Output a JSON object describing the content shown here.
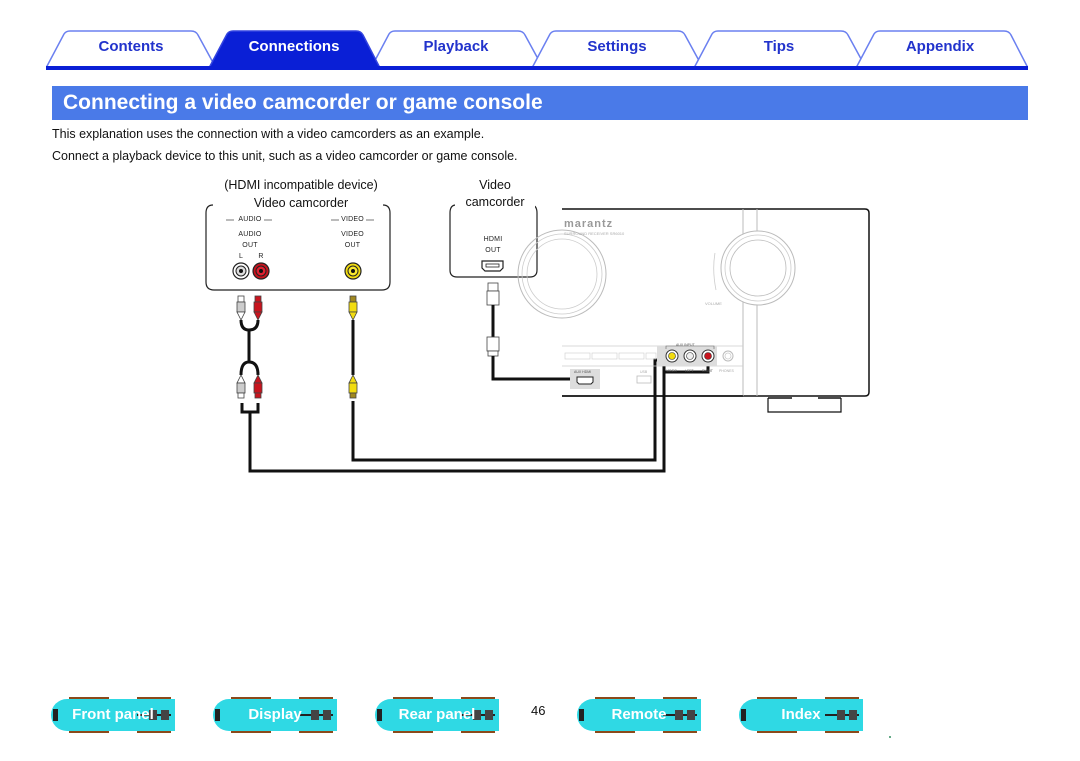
{
  "tabs": [
    {
      "label": "Contents",
      "active": false
    },
    {
      "label": "Connections",
      "active": true
    },
    {
      "label": "Playback",
      "active": false
    },
    {
      "label": "Settings",
      "active": false
    },
    {
      "label": "Tips",
      "active": false
    },
    {
      "label": "Appendix",
      "active": false
    }
  ],
  "colors": {
    "tab_active": "#0a1fd6",
    "tab_border": "#6b80f0",
    "tab_text": "#2233cc",
    "title_bar": "#4a7ae8",
    "nav_button": "#2fd9e4",
    "rca_white": "#ffffff",
    "rca_red": "#c8141e",
    "rca_yellow": "#f2dc10"
  },
  "title": "Connecting a video camcorder or game console",
  "paragraphs": [
    "This explanation uses the connection with a video camcorders as an example.",
    "Connect a playback device to this unit, such as a video camcorder or game console."
  ],
  "diagram": {
    "analog_device": {
      "caption_line1": "(HDMI incompatible device)",
      "caption_line2": "Video camcorder",
      "audio_group": "AUDIO",
      "video_group": "VIDEO",
      "audio_out_line1": "AUDIO",
      "audio_out_line2": "OUT",
      "video_out_line1": "VIDEO",
      "video_out_line2": "OUT",
      "left": "L",
      "right": "R"
    },
    "hdmi_device": {
      "caption_line1": "Video",
      "caption_line2": "camcorder",
      "port_line1": "HDMI",
      "port_line2": "OUT"
    },
    "receiver": {
      "brand": "marantz",
      "model_text": "SURROUND RECEIVER SR6010",
      "volume_label": "VOLUME",
      "aux_input_label": "AUX INPUT",
      "aux_hdmi_label": "AUX HDMI",
      "video_jack": "VIDEO",
      "left_jack": "LEFT",
      "right_jack": "RIGHT",
      "phones_label": "PHONES",
      "usb_label": "USB"
    }
  },
  "bottom_nav": [
    {
      "label": "Front panel"
    },
    {
      "label": "Display"
    },
    {
      "label": "Rear panel"
    },
    {
      "label": "Remote"
    },
    {
      "label": "Index"
    }
  ],
  "page_number": "46"
}
